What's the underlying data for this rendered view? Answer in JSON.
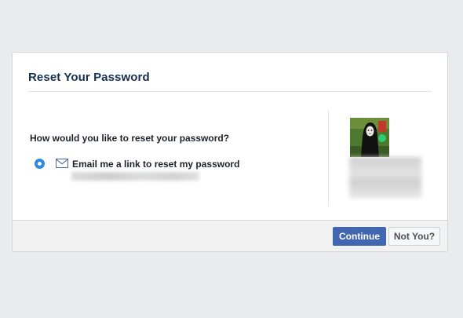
{
  "dialog": {
    "title": "Reset Your Password",
    "question": "How would you like to reset your password?",
    "option": {
      "label": "Email me a link to reset my password",
      "selected": true,
      "icon": "envelope-icon"
    },
    "profile": {
      "avatar": "profile-photo"
    },
    "buttons": {
      "continue_label": "Continue",
      "not_you_label": "Not You?"
    }
  },
  "colors": {
    "background": "#e9ebee",
    "title": "#162f53",
    "primary_button": "#4267b2",
    "radio_selected": "#2d88e6"
  }
}
